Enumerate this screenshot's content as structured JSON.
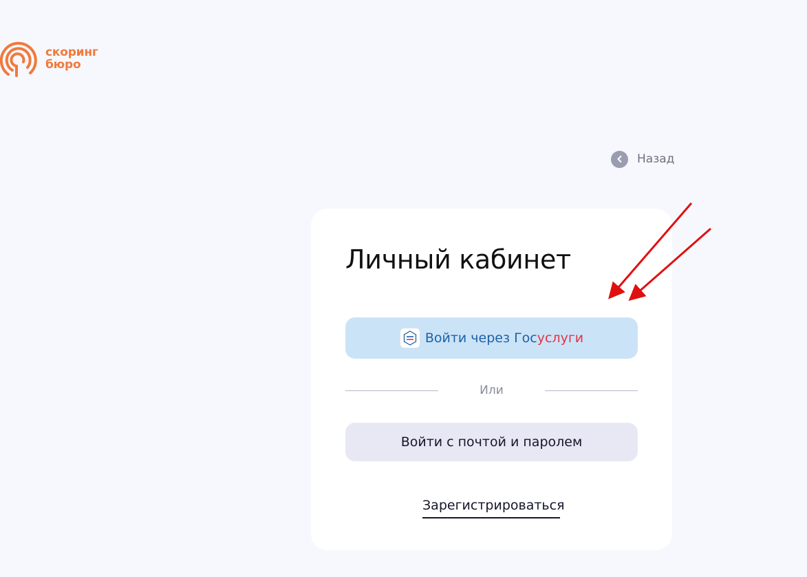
{
  "brand": {
    "line1": "скоринг",
    "line2": "бюро",
    "color": "#f07a3c"
  },
  "nav": {
    "back_label": "Назад",
    "back_icon": "chevron-left-icon"
  },
  "card": {
    "title": "Личный кабинет",
    "gosuslugi_button": {
      "prefix": "Войти через Гос",
      "suffix": "услуги",
      "logo_icon": "gosuslugi-logo-icon"
    },
    "divider_label": "Или",
    "email_button_label": "Войти с почтой и паролем",
    "register_label": "Зарегистрироваться"
  },
  "colors": {
    "accent_orange": "#f07a3c",
    "gos_blue": "#1c62a8",
    "gos_red": "#e33446",
    "annotation_arrow": "#e01010"
  }
}
